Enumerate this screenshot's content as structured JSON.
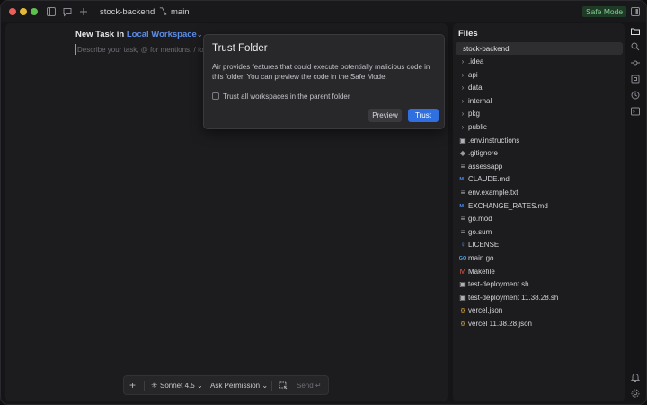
{
  "titlebar": {
    "project": "stock-backend",
    "branch": "main",
    "safe_mode_badge": "Safe Mode"
  },
  "task": {
    "heading_prefix": "New Task in",
    "workspace": "Local Workspace",
    "placeholder": "Describe your task, @ for mentions, / for"
  },
  "trust_modal": {
    "title": "Trust Folder",
    "body": "Air provides features that could execute potentially malicious code in this folder. You can preview the code in the Safe Mode.",
    "checkbox_label": "Trust all workspaces in the parent folder",
    "checkbox_checked": false,
    "preview_label": "Preview",
    "trust_label": "Trust",
    "trust_color": "#2f6fe0"
  },
  "composer": {
    "model": "Sonnet 4.5",
    "permission": "Ask Permission",
    "send_label": "Send"
  },
  "files": {
    "title": "Files",
    "root": "stock-backend",
    "items": [
      {
        "name": ".idea",
        "icon": "chevron-right-icon",
        "kind": "folder"
      },
      {
        "name": "api",
        "icon": "chevron-right-icon",
        "kind": "folder"
      },
      {
        "name": "data",
        "icon": "chevron-right-icon",
        "kind": "folder"
      },
      {
        "name": "internal",
        "icon": "chevron-right-icon",
        "kind": "folder"
      },
      {
        "name": "pkg",
        "icon": "chevron-right-icon",
        "kind": "folder"
      },
      {
        "name": "public",
        "icon": "chevron-right-icon",
        "kind": "folder"
      },
      {
        "name": ".env.instructions",
        "icon": "terminal-file-icon",
        "kind": "file"
      },
      {
        "name": ".gitignore",
        "icon": "git-icon",
        "kind": "file"
      },
      {
        "name": "assessapp",
        "icon": "text-file-icon",
        "kind": "file"
      },
      {
        "name": "CLAUDE.md",
        "icon": "markdown-icon",
        "kind": "file"
      },
      {
        "name": "env.example.txt",
        "icon": "text-file-icon",
        "kind": "file"
      },
      {
        "name": "EXCHANGE_RATES.md",
        "icon": "markdown-icon",
        "kind": "file"
      },
      {
        "name": "go.mod",
        "icon": "text-file-icon",
        "kind": "file"
      },
      {
        "name": "go.sum",
        "icon": "text-file-icon",
        "kind": "file"
      },
      {
        "name": "LICENSE",
        "icon": "license-icon",
        "kind": "file"
      },
      {
        "name": "main.go",
        "icon": "go-icon",
        "kind": "file"
      },
      {
        "name": "Makefile",
        "icon": "makefile-icon",
        "kind": "file"
      },
      {
        "name": "test-deployment.sh",
        "icon": "terminal-file-icon",
        "kind": "file"
      },
      {
        "name": "test-deployment 11.38.28.sh",
        "icon": "terminal-file-icon",
        "kind": "file"
      },
      {
        "name": "vercel.json",
        "icon": "json-icon",
        "kind": "file"
      },
      {
        "name": "vercel 11.38.28.json",
        "icon": "json-icon",
        "kind": "file"
      }
    ]
  },
  "colors": {
    "accent": "#5b8de9",
    "safe_mode": "#7fcf8f",
    "markdown": "#4c8ef0",
    "go": "#4ca8e6",
    "json": "#e0a43a",
    "makefile": "#e05a4f"
  }
}
